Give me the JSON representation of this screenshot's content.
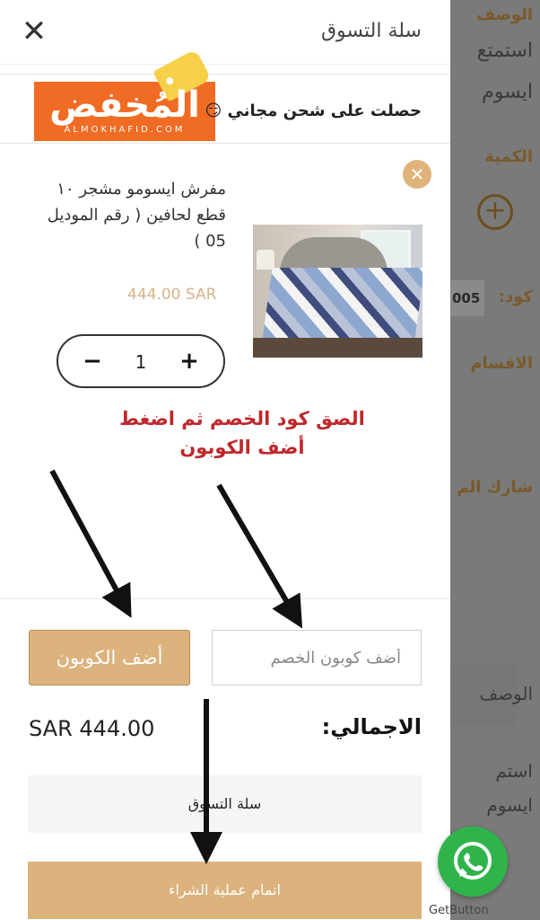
{
  "background_page": {
    "label_description": "الوصف",
    "text_line1": "استمتع",
    "text_line2": "ايسوم",
    "label_quantity": "الكمية",
    "code_label": "كود:",
    "code_value": "005",
    "label_sections": "الاقسام",
    "label_share": "شارك الم",
    "desc_tab": "الوصف",
    "text_line3": "استم",
    "text_line4": "ايسوم"
  },
  "drawer": {
    "title": "سلة التسوق",
    "close_icon": "close-icon"
  },
  "promo": {
    "text": "حصلت على شحن مجاني 😏",
    "logo_word": "المُخفض",
    "logo_sub": "ALMOKHAFID.COM",
    "logo_color": "#f06b23"
  },
  "cart_item": {
    "name": "مفرش ايسومو مشجر ١٠ قطع لحافين ( رقم الموديل 05 )",
    "price": "444.00 SAR",
    "quantity": "1",
    "minus": "−",
    "plus": "+",
    "remove": "✕"
  },
  "annotation": {
    "line1": "الصق كود الخصم ثم اضغط",
    "line2": "أضف الكوبون"
  },
  "coupon": {
    "placeholder": "أضف كوبون الخصم",
    "button": "أضف الكوبون"
  },
  "summary": {
    "total_label": "الاجمالي:",
    "total_value": "SAR 444.00"
  },
  "actions": {
    "cart_button": "سلة التسوق",
    "checkout_button": "اتمام عملية الشراء"
  },
  "widgets": {
    "getbutton_text": "GetButton",
    "whatsapp_icon": "whatsapp-icon"
  },
  "colors": {
    "accent": "#dcb27d",
    "annotation_red": "#c0282b",
    "whatsapp_green": "#2fb44c"
  }
}
